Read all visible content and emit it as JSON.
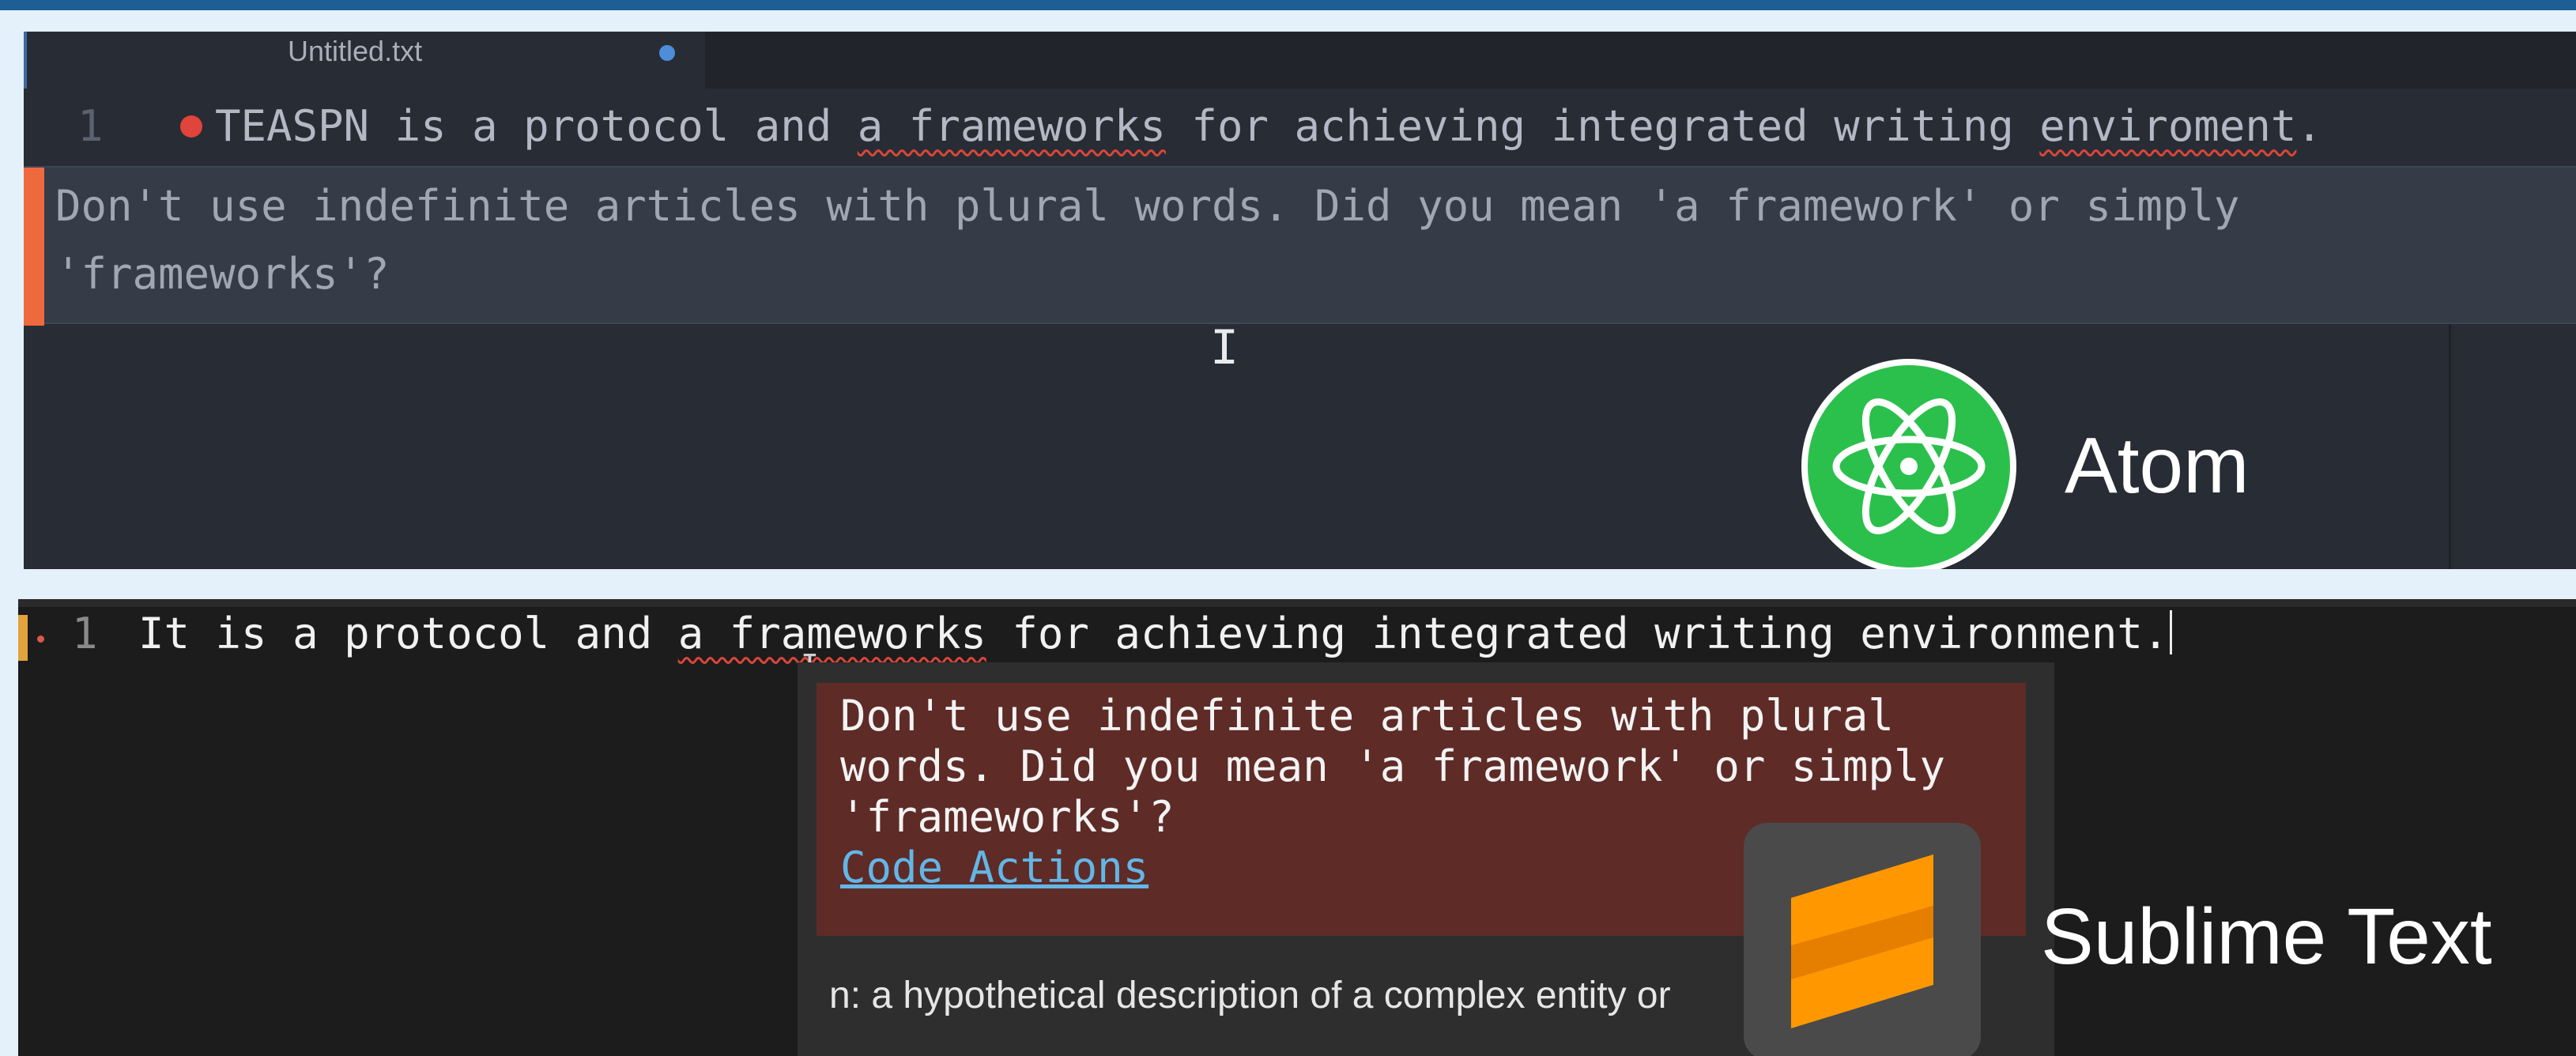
{
  "atom": {
    "tab_title": "Untitled.txt",
    "line_number": "1",
    "line_text_before": "TEASPN is a protocol and ",
    "line_text_error": "a frameworks",
    "line_text_middle": " for achieving integrated writing ",
    "line_text_error2": "enviroment",
    "line_text_after": ".",
    "message": "Don't use indefinite articles with plural words. Did you mean 'a framework' or simply\n'frameworks'?",
    "label": "Atom"
  },
  "sublime": {
    "line_number": "1",
    "line_text_before": "It is a protocol and ",
    "line_text_error": "a frameworks",
    "line_text_after": " for achieving integrated writing environment.",
    "message": "Don't use indefinite articles with plural\nwords. Did you mean 'a framework' or simply\n'frameworks'?",
    "code_actions": "Code Actions",
    "definition": "n: a hypothetical description of a complex entity or",
    "label": "Sublime Text"
  },
  "colors": {
    "page_background": "#e4f1fb",
    "top_bar": "#1d5f95",
    "atom_accent": "#ee6a3e",
    "sublime_error_bg": "#5e2b27",
    "link": "#63b6e6"
  }
}
